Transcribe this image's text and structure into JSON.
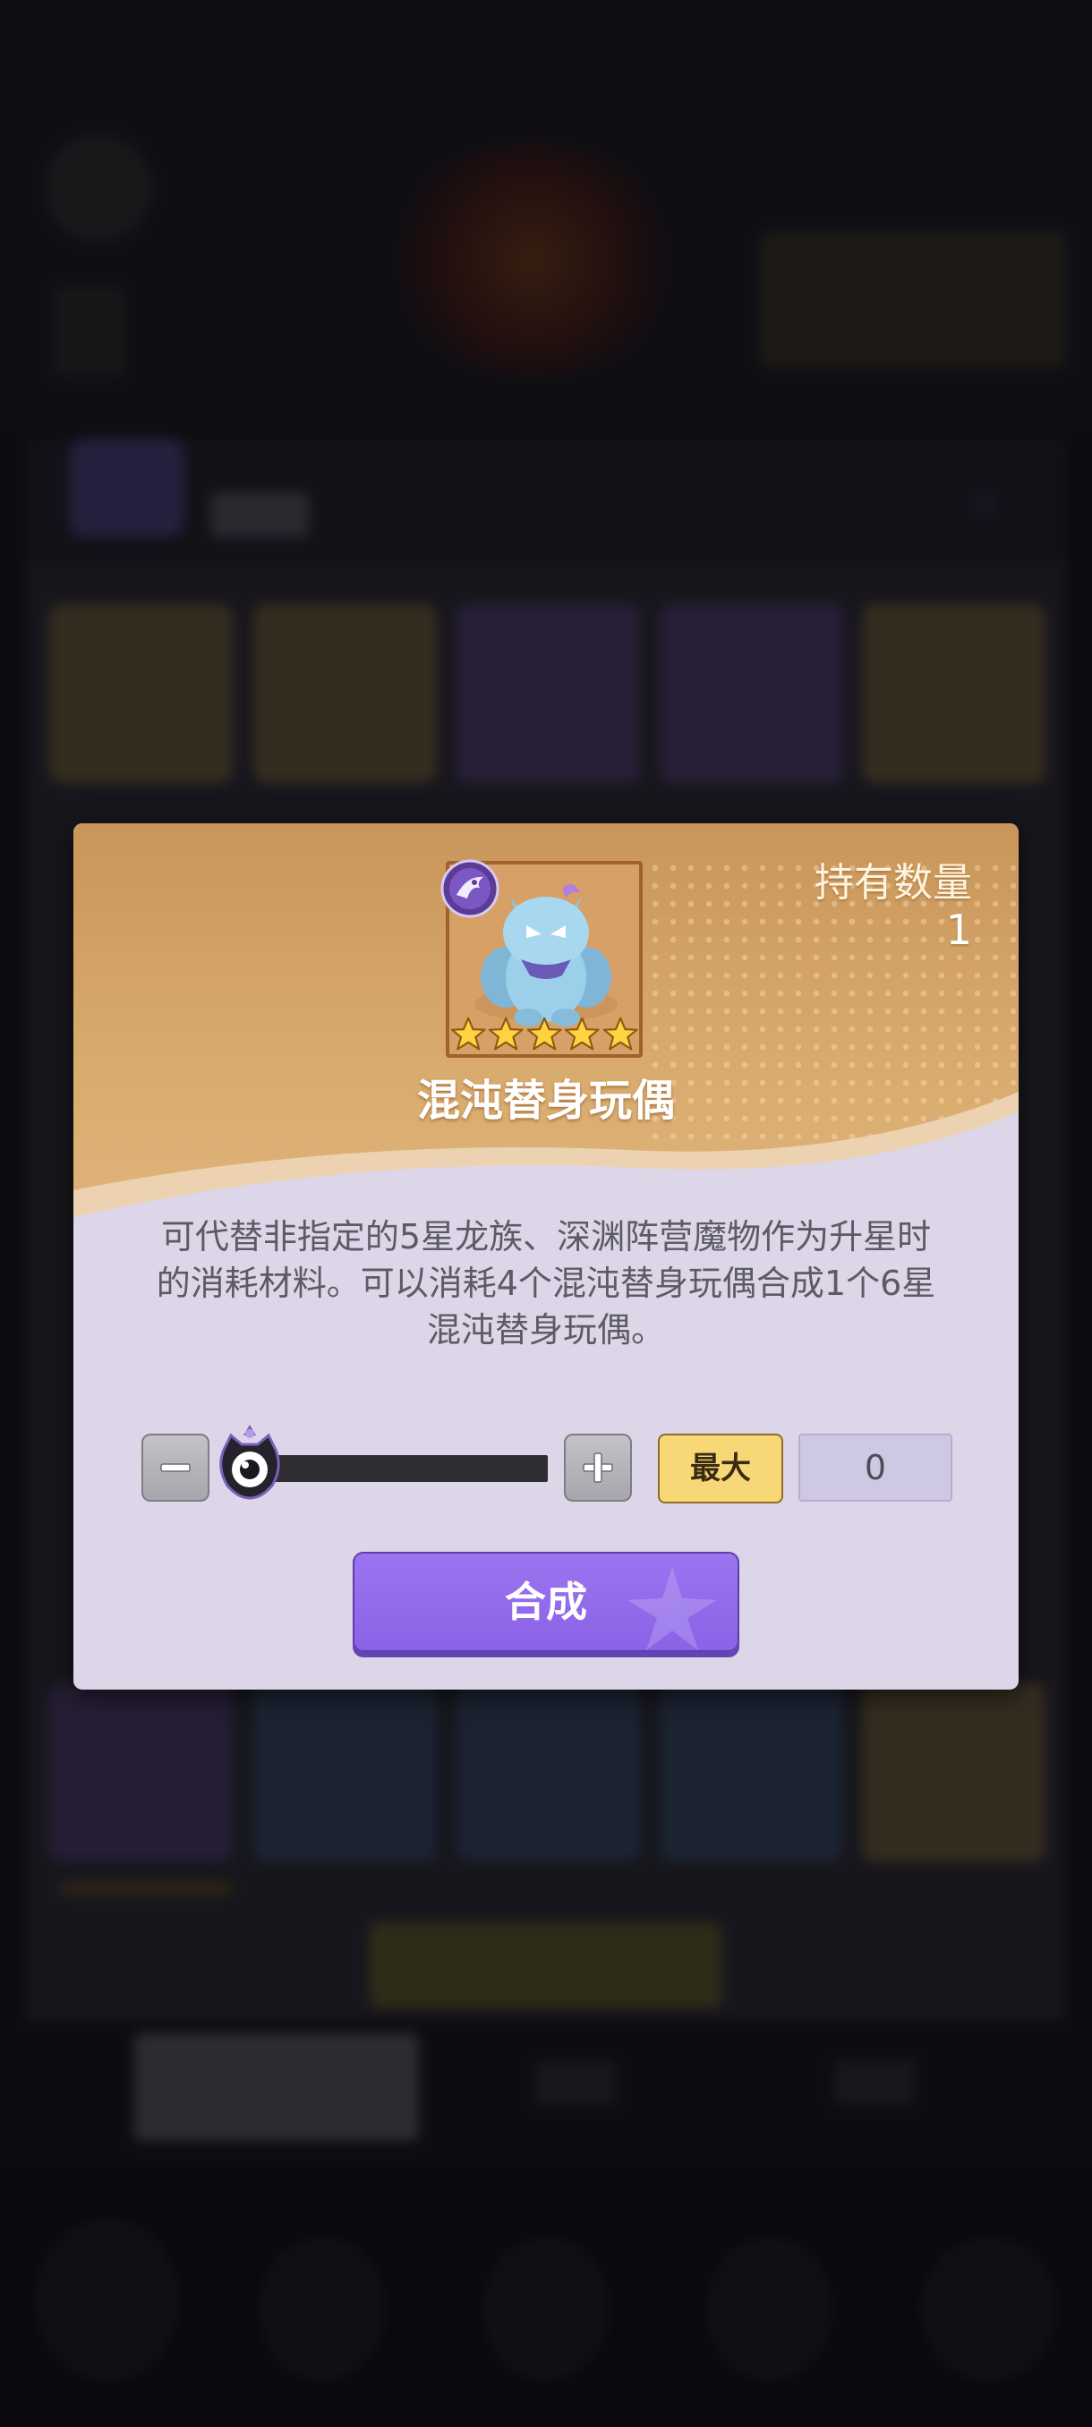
{
  "dialog": {
    "item_name": "混沌替身玩偶",
    "hold_label": "持有数量",
    "hold_count": "1",
    "star_count": 5,
    "description": "可代替非指定的5星龙族、深渊阵营魔物作为升星时的消耗材料。可以消耗4个混沌替身玩偶合成1个6星混沌替身玩偶。",
    "quantity": "0",
    "max_label": "最大",
    "craft_label": "合成"
  },
  "icons": {
    "minus": "minus-icon",
    "plus": "plus-icon",
    "faction": "abyss-faction-icon",
    "slider_thumb": "eye-slider-thumb-icon",
    "star": "star-icon"
  },
  "colors": {
    "craft_button": "#8a63e6",
    "max_button": "#f8d876",
    "dialog_top": "#d7a96c",
    "dialog_body": "#dcd6e8"
  }
}
